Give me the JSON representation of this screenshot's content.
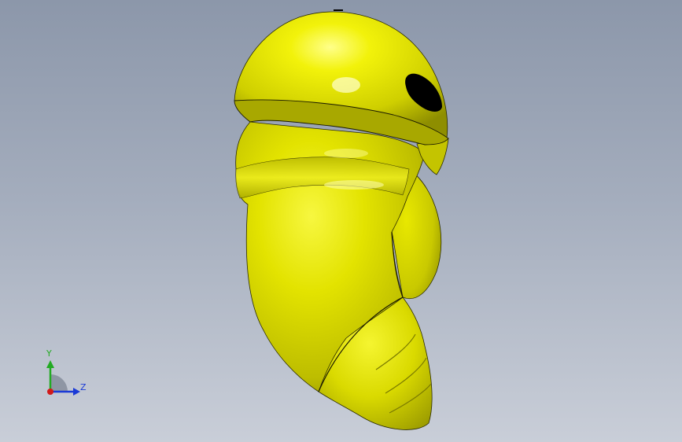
{
  "viewport": {
    "background_top": "#8c97aa",
    "background_bottom": "#c9ced8"
  },
  "model": {
    "part_color": "#e6e600",
    "edge_color": "#1a1a00",
    "eye_color": "#000000"
  },
  "triad": {
    "y_label": "Y",
    "z_label": "Z",
    "y_color": "#22aa22",
    "z_color": "#1a3ad6",
    "x_color": "#d11a1a"
  }
}
